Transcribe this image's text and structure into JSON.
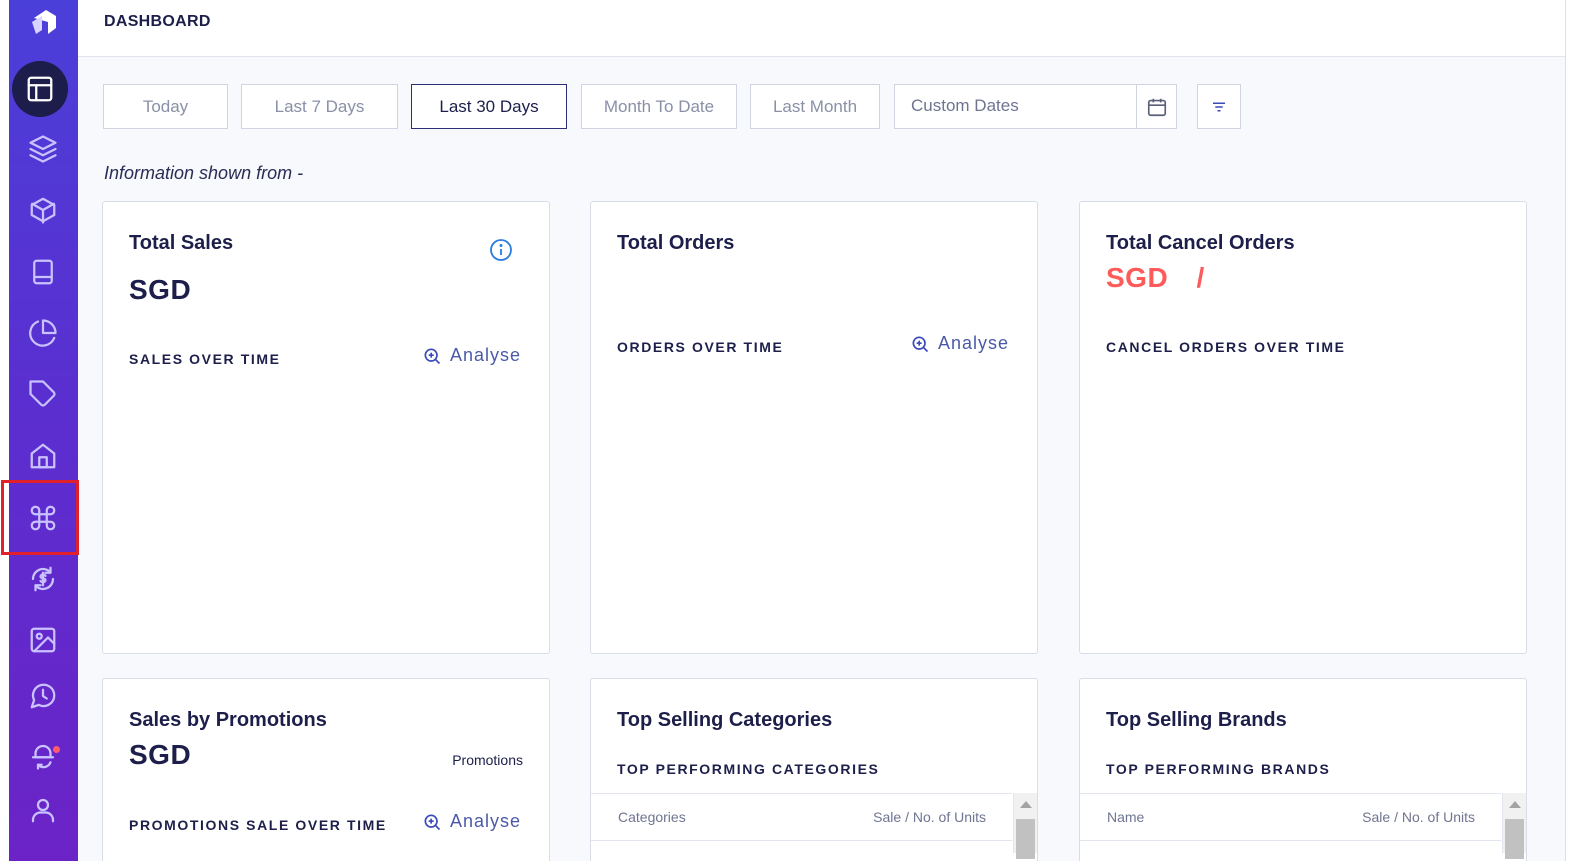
{
  "header": {
    "title": "DASHBOARD"
  },
  "filters": {
    "buttons": [
      "Today",
      "Last 7 Days",
      "Last 30 Days",
      "Month To Date",
      "Last Month"
    ],
    "active": "Last 30 Days",
    "custom_dates_label": "Custom Dates"
  },
  "info_line": "Information shown from -",
  "cards": {
    "total_sales": {
      "title": "Total Sales",
      "value": "SGD",
      "subtitle": "SALES OVER TIME",
      "analyse": "Analyse"
    },
    "total_orders": {
      "title": "Total Orders",
      "subtitle": "ORDERS OVER TIME",
      "analyse": "Analyse"
    },
    "total_cancel": {
      "title": "Total Cancel Orders",
      "value": "SGD",
      "separator": "/",
      "subtitle": "CANCEL ORDERS OVER TIME"
    },
    "promotions": {
      "title": "Sales by Promotions",
      "value": "SGD",
      "label": "Promotions",
      "subtitle": "PROMOTIONS SALE OVER TIME",
      "analyse": "Analyse"
    },
    "categories": {
      "title": "Top Selling Categories",
      "subtitle": "TOP PERFORMING CATEGORIES",
      "col1": "Categories",
      "col2": "Sale / No. of Units"
    },
    "brands": {
      "title": "Top Selling Brands",
      "subtitle": "TOP PERFORMING BRANDS",
      "col1": "Name",
      "col2": "Sale / No. of Units"
    }
  },
  "sidebar": {
    "icons": [
      "logo-icon",
      "dashboard-icon",
      "layers-icon",
      "box-icon",
      "book-icon",
      "pie-chart-icon",
      "tag-icon",
      "home-icon",
      "command-icon",
      "dollar-refresh-icon",
      "image-icon",
      "chat-icon",
      "bell-sync-icon",
      "user-icon"
    ]
  },
  "colors": {
    "accent": "#4b3fd9",
    "dark": "#1c1d4b",
    "red": "#ff5a5a",
    "highlight": "#e0202a"
  }
}
